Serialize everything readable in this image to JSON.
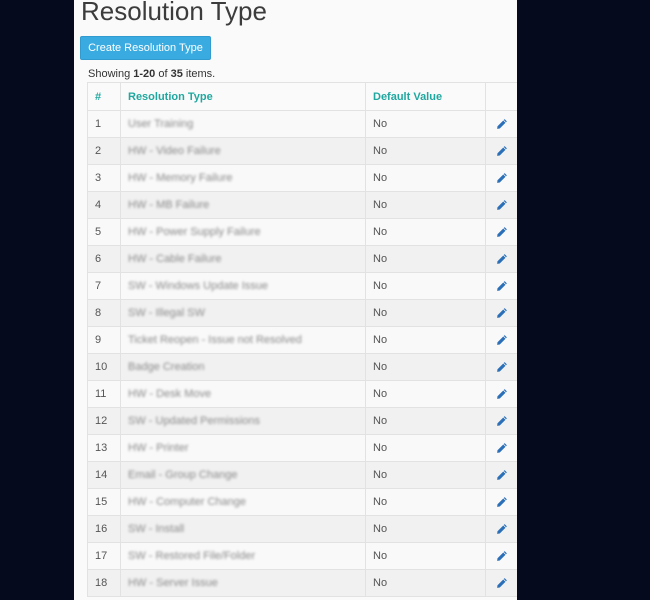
{
  "header": {
    "title": "Resolution Type",
    "create_button_label": "Create Resolution Type"
  },
  "summary": {
    "prefix": "Showing ",
    "range": "1-20",
    "of": " of ",
    "total": "35",
    "suffix": " items."
  },
  "table": {
    "columns": [
      "#",
      "Resolution Type",
      "Default Value",
      ""
    ],
    "rows": [
      {
        "num": "1",
        "type": "User Training",
        "default": "No"
      },
      {
        "num": "2",
        "type": "HW - Video Failure",
        "default": "No"
      },
      {
        "num": "3",
        "type": "HW - Memory Failure",
        "default": "No"
      },
      {
        "num": "4",
        "type": "HW - MB Failure",
        "default": "No"
      },
      {
        "num": "5",
        "type": "HW - Power Supply Failure",
        "default": "No"
      },
      {
        "num": "6",
        "type": "HW - Cable Failure",
        "default": "No"
      },
      {
        "num": "7",
        "type": "SW - Windows Update Issue",
        "default": "No"
      },
      {
        "num": "8",
        "type": "SW - Illegal SW",
        "default": "No"
      },
      {
        "num": "9",
        "type": "Ticket Reopen - Issue not Resolved",
        "default": "No"
      },
      {
        "num": "10",
        "type": "Badge Creation",
        "default": "No"
      },
      {
        "num": "11",
        "type": "HW - Desk Move",
        "default": "No"
      },
      {
        "num": "12",
        "type": "SW - Updated Permissions",
        "default": "No"
      },
      {
        "num": "13",
        "type": "HW - Printer",
        "default": "No"
      },
      {
        "num": "14",
        "type": "Email - Group Change",
        "default": "No"
      },
      {
        "num": "15",
        "type": "HW - Computer Change",
        "default": "No"
      },
      {
        "num": "16",
        "type": "SW - Install",
        "default": "No"
      },
      {
        "num": "17",
        "type": "SW - Restored File/Folder",
        "default": "No"
      },
      {
        "num": "18",
        "type": "HW - Server Issue",
        "default": "No"
      }
    ]
  },
  "icons": {
    "edit": "pencil-icon"
  },
  "colors": {
    "accent": "#3aabe0",
    "header_text": "#20a8a0",
    "pencil": "#2a6fb8",
    "background": "#050a1c"
  }
}
